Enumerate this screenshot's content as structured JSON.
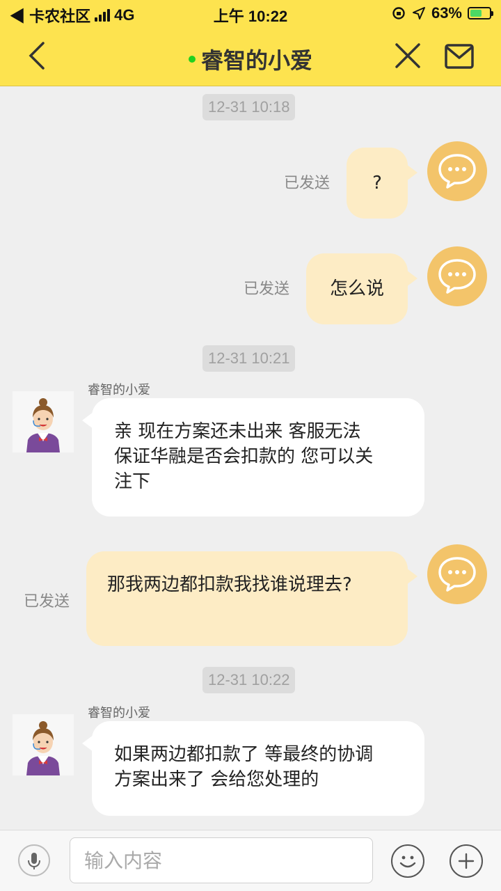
{
  "status_bar": {
    "back_app": "◀ 卡农社区",
    "network": "4G",
    "time": "上午 10:22",
    "battery_percent": "63%",
    "battery_level": 0.63
  },
  "header": {
    "title": "睿智的小爱",
    "back_icon": "chevron-left-icon",
    "close_icon": "close-icon",
    "mail_icon": "mail-icon"
  },
  "colors": {
    "header_bg": "#fde34f",
    "my_bubble": "#fdecc5",
    "their_bubble": "#ffffff",
    "online": "#22d11e",
    "avatar_bg": "#f3c46a"
  },
  "timestamps": [
    "12-31 10:18",
    "12-31 10:21",
    "12-31 10:22"
  ],
  "messages": [
    {
      "from": "me",
      "text": "?",
      "status": "已发送"
    },
    {
      "from": "me",
      "text": "怎么说",
      "status": "已发送"
    },
    {
      "from": "agent",
      "sender": "睿智的小爱",
      "lines": [
        "亲 现在方案还未出来 客服无法",
        "保证华融是否会扣款的 您可以关",
        "注下"
      ]
    },
    {
      "from": "me",
      "text": "那我两边都扣款我找谁说理去?",
      "status": "已发送"
    },
    {
      "from": "agent",
      "sender": "睿智的小爱",
      "lines": [
        "如果两边都扣款了 等最终的协调",
        "方案出来了 会给您处理的"
      ]
    }
  ],
  "input": {
    "placeholder": "输入内容",
    "mic_icon": "microphone-icon",
    "emoji_icon": "smiley-icon",
    "plus_icon": "plus-icon"
  }
}
